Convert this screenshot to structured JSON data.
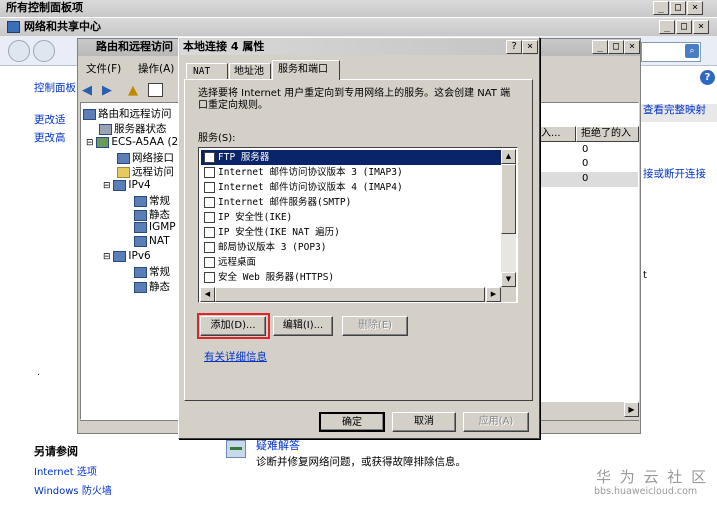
{
  "outer_window": {
    "title": "所有控制面板项"
  },
  "network_window": {
    "title": "网络和共享中心"
  },
  "left_panel": {
    "home": "控制面板",
    "links": [
      "更改适",
      "更改高"
    ],
    "see_also_title": "另请参阅",
    "see_also": [
      "Internet 选项",
      "Windows 防火墙"
    ]
  },
  "right_fragments": {
    "link1": "查看完整映射",
    "link2": "接或断开连接",
    "letter": "t"
  },
  "rras_window": {
    "title": "路由和远程访问",
    "menu": [
      "文件(F)",
      "操作(A)"
    ],
    "tree": [
      {
        "label": "路由和远程访问",
        "icon": "server-icon"
      },
      {
        "label": "服务器状态",
        "icon": "status-icon"
      },
      {
        "label": "ECS-A5AA (2",
        "icon": "computer-icon"
      },
      {
        "label": "网络接口",
        "icon": "network-icon"
      },
      {
        "label": "远程访问",
        "icon": "folder-icon"
      },
      {
        "label": "IPv4",
        "icon": "network-icon"
      },
      {
        "label": "常规",
        "icon": "network-icon"
      },
      {
        "label": "静态",
        "icon": "network-icon"
      },
      {
        "label": "IGMP",
        "icon": "network-icon"
      },
      {
        "label": "NAT",
        "icon": "network-icon"
      },
      {
        "label": "IPv6",
        "icon": "network-icon"
      },
      {
        "label": "常规",
        "icon": "network-icon"
      },
      {
        "label": "静态",
        "icon": "network-icon"
      }
    ],
    "columns": [
      "入...",
      "拒绝了的入"
    ],
    "values": [
      "0",
      "0",
      "0"
    ]
  },
  "dialog": {
    "title": "本地连接 4 属性",
    "tabs": [
      "NAT",
      "地址池",
      "服务和端口"
    ],
    "description": "选择要将 Internet 用户重定向到专用网络上的服务。这会创建 NAT 端口重定向规则。",
    "services_label": "服务(S):",
    "services": [
      "FTP 服务器",
      "Internet 邮件访问协议版本 3 (IMAP3)",
      "Internet 邮件访问协议版本 4 (IMAP4)",
      "Internet 邮件服务器(SMTP)",
      "IP 安全性(IKE)",
      "IP 安全性(IKE NAT 遍历)",
      "邮局协议版本 3 (POP3)",
      "远程桌面",
      "安全 Web 服务器(HTTPS)"
    ],
    "buttons": {
      "add": "添加(D)...",
      "edit": "编辑(I)...",
      "delete": "删除(E)"
    },
    "more_info": "有关详细信息",
    "ok": "确定",
    "cancel": "取消",
    "apply": "应用(A)"
  },
  "troubleshoot": {
    "title": "疑难解答",
    "desc": "诊断并修复网络问题，或获得故障排除信息。"
  },
  "watermark": {
    "line1": "华 为 云 社 区",
    "line2": "bbs.huaweicloud.com"
  },
  "colors": {
    "selection": "#0a246a",
    "highlight_box": "#e0242a",
    "link": "#0033cc"
  }
}
